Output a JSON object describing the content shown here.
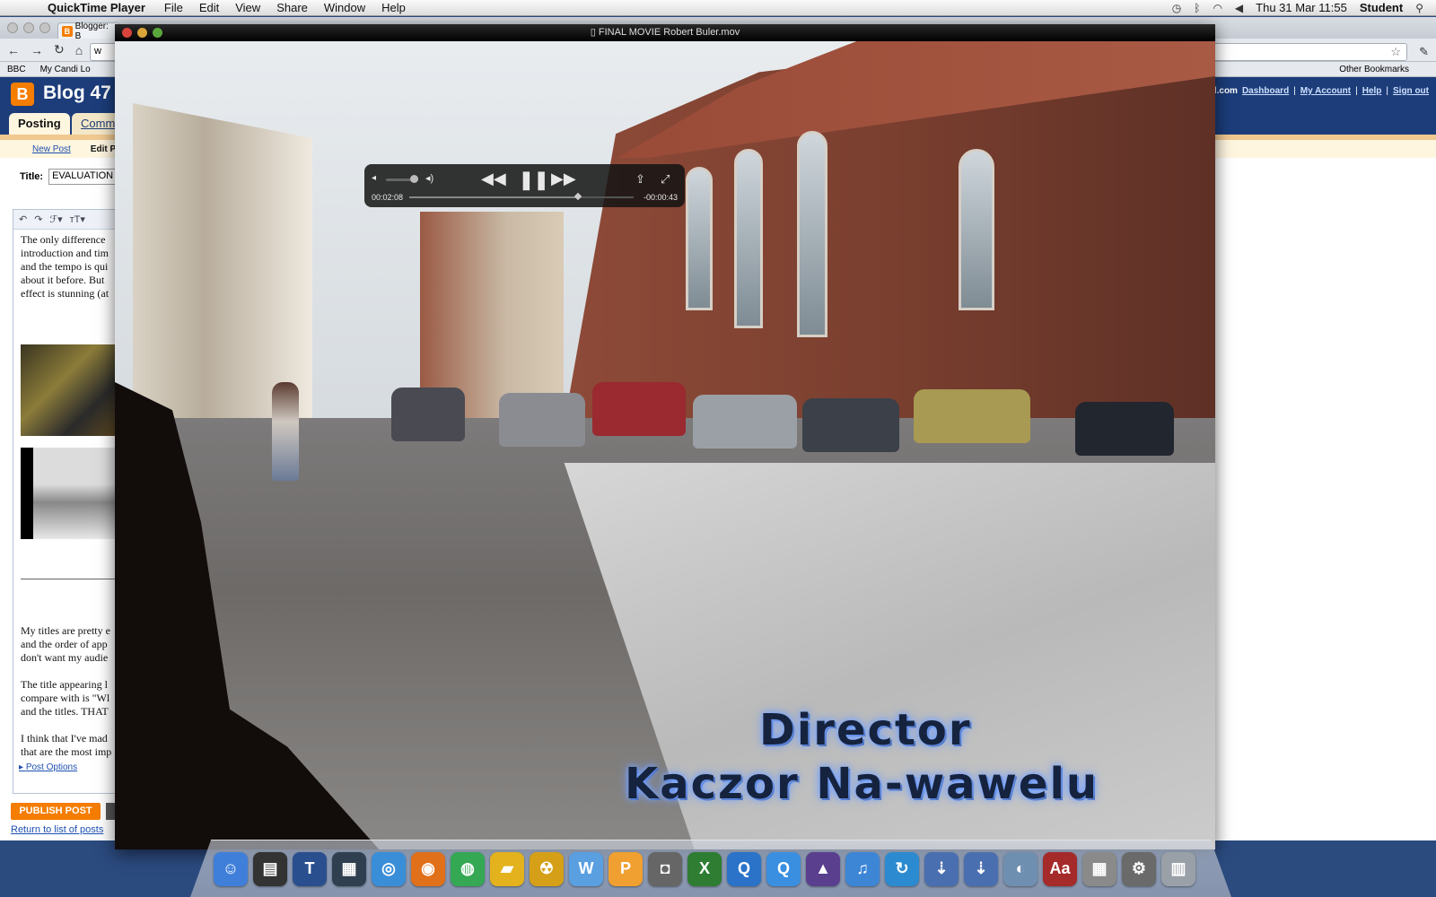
{
  "menubar": {
    "apple": "",
    "app": "QuickTime Player",
    "menus": [
      "File",
      "Edit",
      "View",
      "Share",
      "Window",
      "Help"
    ],
    "datetime": "Thu 31 Mar  11:55",
    "user": "Student"
  },
  "browser": {
    "tab_title": "Blogger: B",
    "address": "w",
    "bookmarks": [
      "BBC",
      "My Candi Lo"
    ],
    "other_bookmarks": "Other Bookmarks",
    "blog_title": "Blog 47",
    "account_email": "gmail.com",
    "account_links": [
      "Dashboard",
      "My Account",
      "Help",
      "Sign out"
    ],
    "tabs": {
      "posting": "Posting",
      "comments": "Comm"
    },
    "subnav": {
      "new_post": "New Post",
      "edit_posts": "Edit P"
    },
    "title_label": "Title:",
    "title_value": "EVALUATION",
    "editor_para1": [
      "The only difference",
      "introduction and tim",
      "and the tempo is qui",
      "about it before. But",
      "effect is stunning (at"
    ],
    "editor_para2": [
      "My titles are pretty e",
      "and the order of app",
      "don't want my audie",
      "",
      "The title appearing l",
      "compare with is \"Wl",
      "and the titles. THAT",
      "",
      "I think that I've mad",
      "that are the most imp"
    ],
    "post_options": "Post Options",
    "publish": "PUBLISH POST",
    "return_link": "Return to list of posts"
  },
  "quicktime": {
    "window_title": "FINAL MOVIE Robert Buler.mov",
    "current_time": "00:02:08",
    "remaining_time": "-00:00:43",
    "progress_fraction": 0.75,
    "volume_fraction": 0.85,
    "credit_line1": "Director",
    "credit_line2": "Kaczor Na-wawelu"
  },
  "dock": {
    "apps": [
      {
        "name": "finder",
        "glyph": "☺",
        "color": "#3f7fd9"
      },
      {
        "name": "clapper",
        "glyph": "▤",
        "color": "#333333"
      },
      {
        "name": "text-app",
        "glyph": "T",
        "color": "#2a4f8f"
      },
      {
        "name": "film-app",
        "glyph": "▦",
        "color": "#2f3f4f"
      },
      {
        "name": "safari",
        "glyph": "◎",
        "color": "#3a8ed8"
      },
      {
        "name": "firefox",
        "glyph": "◉",
        "color": "#e0701a"
      },
      {
        "name": "chrome",
        "glyph": "◍",
        "color": "#34a853"
      },
      {
        "name": "ticket-app",
        "glyph": "▰",
        "color": "#e3b21c"
      },
      {
        "name": "burn-app",
        "glyph": "☢",
        "color": "#d5a018"
      },
      {
        "name": "w-app",
        "glyph": "W",
        "color": "#5a9fe0"
      },
      {
        "name": "p-app",
        "glyph": "P",
        "color": "#f0a030"
      },
      {
        "name": "camera-app",
        "glyph": "◘",
        "color": "#666666"
      },
      {
        "name": "x-app",
        "glyph": "X",
        "color": "#2e7d32"
      },
      {
        "name": "quicktime-app",
        "glyph": "Q",
        "color": "#2a73c9"
      },
      {
        "name": "quicktime-x-app",
        "glyph": "Q",
        "color": "#3b8fe0"
      },
      {
        "name": "hat-app",
        "glyph": "▲",
        "color": "#5a3f8f"
      },
      {
        "name": "itunes",
        "glyph": "♫",
        "color": "#3d86d6"
      },
      {
        "name": "sync-app",
        "glyph": "↻",
        "color": "#2c8ad0"
      },
      {
        "name": "downloads",
        "glyph": "⇣",
        "color": "#4a6fb0"
      },
      {
        "name": "documents",
        "glyph": "⇣",
        "color": "#4a6fb0"
      },
      {
        "name": "preview",
        "glyph": "◐",
        "color": "#6f8fb0"
      },
      {
        "name": "dictionary",
        "glyph": "Aa",
        "color": "#a52a2a"
      },
      {
        "name": "calculator",
        "glyph": "▦",
        "color": "#8a8a8a"
      },
      {
        "name": "system-prefs",
        "glyph": "⚙",
        "color": "#6a6a6a"
      },
      {
        "name": "trash",
        "glyph": "▥",
        "color": "#9aa0a8"
      }
    ]
  }
}
